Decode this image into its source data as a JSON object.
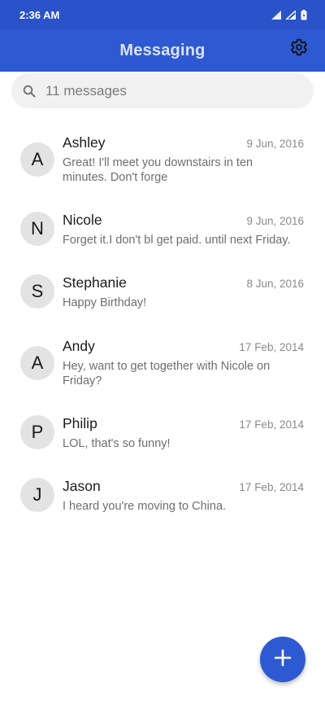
{
  "status_bar": {
    "time": "2:36 AM",
    "icons": [
      "signal-icon",
      "wifi-icon",
      "battery-icon"
    ]
  },
  "app_bar": {
    "title": "Messaging",
    "settings_icon": "gear-icon"
  },
  "search": {
    "placeholder": "11 messages",
    "icon": "search-icon"
  },
  "conversations": [
    {
      "initial": "A",
      "name": "Ashley",
      "date": "9 Jun, 2016",
      "snippet": "Great! I'll meet you downstairs in ten minutes. Don't forge"
    },
    {
      "initial": "N",
      "name": "Nicole",
      "date": "9 Jun, 2016",
      "snippet": "Forget it.I don't bl get paid. until next Friday."
    },
    {
      "initial": "S",
      "name": "Stephanie",
      "date": "8 Jun, 2016",
      "snippet": "Happy Birthday!"
    },
    {
      "initial": "A",
      "name": "Andy",
      "date": "17 Feb, 2014",
      "snippet": "Hey, want to get together with Nicole on Friday?"
    },
    {
      "initial": "P",
      "name": "Philip",
      "date": "17 Feb, 2014",
      "snippet": "LOL, that's so funny!"
    },
    {
      "initial": "J",
      "name": "Jason",
      "date": "17 Feb, 2014",
      "snippet": "I heard you're moving to China."
    }
  ],
  "fab": {
    "icon": "plus-icon"
  },
  "colors": {
    "primary": "#2d5ad3",
    "status_bar": "#2a52c9",
    "title_text": "#d9e2fb",
    "search_bg": "#f1f1f1",
    "avatar_bg": "#e3e3e3"
  }
}
